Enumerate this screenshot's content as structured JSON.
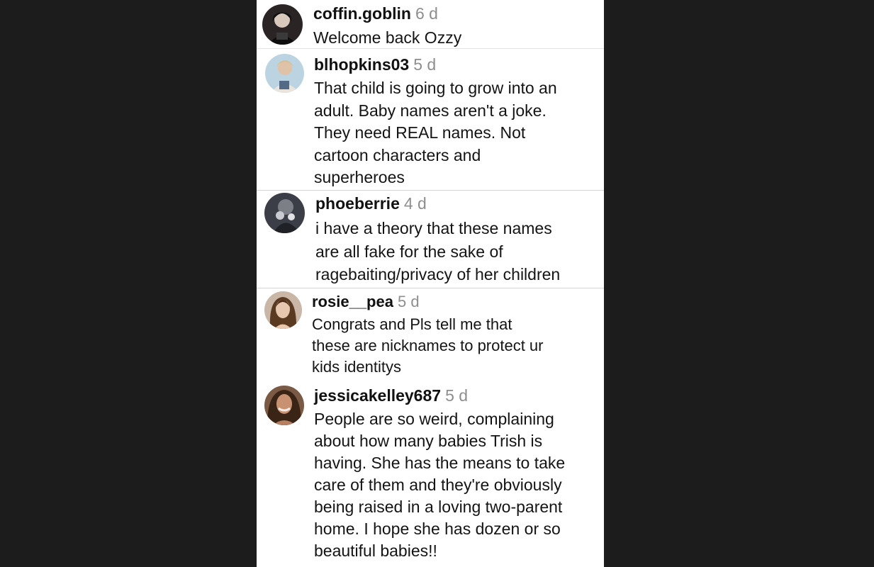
{
  "comments": [
    {
      "username": "coffin.goblin",
      "age": "6 d",
      "text": "Welcome back Ozzy",
      "avatar": "avatar-coffin-goblin"
    },
    {
      "username": "blhopkins03",
      "age": "5 d",
      "text": "That child is going to grow into an\nadult. Baby names aren't a joke.\nThey need REAL names. Not\ncartoon characters and\nsuperheroes",
      "avatar": "avatar-blhopkins03"
    },
    {
      "username": "phoeberrie",
      "age": "4 d",
      "text": "i have a theory that these names\nare all fake for the sake of\nragebaiting/privacy of her children",
      "avatar": "avatar-phoeberrie"
    },
    {
      "username": "rosie__pea",
      "age": "5 d",
      "text": "Congrats and Pls tell me that\nthese are nicknames to protect ur\nkids identitys",
      "avatar": "avatar-rosie-pea"
    },
    {
      "username": "jessicakelley687",
      "age": "5 d",
      "text": "People are so weird, complaining\nabout how many babies Trish is\nhaving. She has the means to take\ncare of them and they're obviously\nbeing raised in a loving two-parent\nhome. I hope she has dozen or so\nbeautiful babies!!",
      "avatar": "avatar-jessicakelley687"
    }
  ],
  "colors": {
    "background": "#1c1c1c",
    "panel": "#ffffff",
    "username": "#111111",
    "age": "#8e8e8e"
  }
}
